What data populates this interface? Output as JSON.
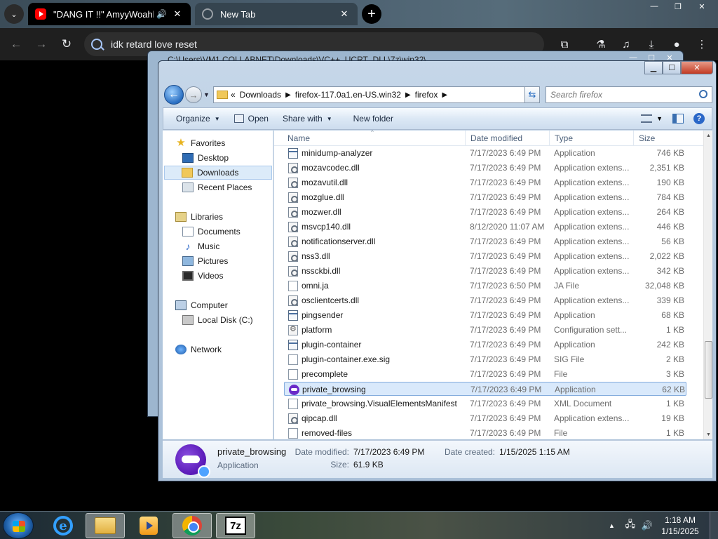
{
  "browser": {
    "tabs": [
      {
        "title": "\"DANG IT !!\" AmyyWoahh"
      },
      {
        "title": "New Tab"
      }
    ],
    "omnibox_value": "idk retard love reset"
  },
  "back_window": {
    "title": "C:\\Users\\VM1.COLLABNET\\Downloads\\VC++_UCRT_DLL\\7z\\win32\\"
  },
  "window": {
    "breadcrumb": [
      "Downloads",
      "firefox-117.0a1.en-US.win32",
      "firefox"
    ],
    "search_placeholder": "Search firefox",
    "toolbar": {
      "organize": "Organize",
      "open": "Open",
      "share_with": "Share with",
      "new_folder": "New folder"
    },
    "nav": {
      "favorites": "Favorites",
      "desktop": "Desktop",
      "downloads": "Downloads",
      "recent_places": "Recent Places",
      "libraries": "Libraries",
      "documents": "Documents",
      "music": "Music",
      "pictures": "Pictures",
      "videos": "Videos",
      "computer": "Computer",
      "local_disk": "Local Disk (C:)",
      "network": "Network"
    },
    "columns": {
      "name": "Name",
      "date": "Date modified",
      "type": "Type",
      "size": "Size"
    },
    "files": [
      {
        "name": "minidump-analyzer",
        "date": "7/17/2023 6:49 PM",
        "type": "Application",
        "size": "746 KB",
        "icon": "app"
      },
      {
        "name": "mozavcodec.dll",
        "date": "7/17/2023 6:49 PM",
        "type": "Application extens...",
        "size": "2,351 KB",
        "icon": "dll"
      },
      {
        "name": "mozavutil.dll",
        "date": "7/17/2023 6:49 PM",
        "type": "Application extens...",
        "size": "190 KB",
        "icon": "dll"
      },
      {
        "name": "mozglue.dll",
        "date": "7/17/2023 6:49 PM",
        "type": "Application extens...",
        "size": "784 KB",
        "icon": "dll"
      },
      {
        "name": "mozwer.dll",
        "date": "7/17/2023 6:49 PM",
        "type": "Application extens...",
        "size": "264 KB",
        "icon": "dll"
      },
      {
        "name": "msvcp140.dll",
        "date": "8/12/2020 11:07 AM",
        "type": "Application extens...",
        "size": "446 KB",
        "icon": "dll"
      },
      {
        "name": "notificationserver.dll",
        "date": "7/17/2023 6:49 PM",
        "type": "Application extens...",
        "size": "56 KB",
        "icon": "dll"
      },
      {
        "name": "nss3.dll",
        "date": "7/17/2023 6:49 PM",
        "type": "Application extens...",
        "size": "2,022 KB",
        "icon": "dll"
      },
      {
        "name": "nssckbi.dll",
        "date": "7/17/2023 6:49 PM",
        "type": "Application extens...",
        "size": "342 KB",
        "icon": "dll"
      },
      {
        "name": "omni.ja",
        "date": "7/17/2023 6:50 PM",
        "type": "JA File",
        "size": "32,048 KB",
        "icon": "file"
      },
      {
        "name": "osclientcerts.dll",
        "date": "7/17/2023 6:49 PM",
        "type": "Application extens...",
        "size": "339 KB",
        "icon": "dll"
      },
      {
        "name": "pingsender",
        "date": "7/17/2023 6:49 PM",
        "type": "Application",
        "size": "68 KB",
        "icon": "app"
      },
      {
        "name": "platform",
        "date": "7/17/2023 6:49 PM",
        "type": "Configuration sett...",
        "size": "1 KB",
        "icon": "conf"
      },
      {
        "name": "plugin-container",
        "date": "7/17/2023 6:49 PM",
        "type": "Application",
        "size": "242 KB",
        "icon": "app"
      },
      {
        "name": "plugin-container.exe.sig",
        "date": "7/17/2023 6:49 PM",
        "type": "SIG File",
        "size": "2 KB",
        "icon": "file"
      },
      {
        "name": "precomplete",
        "date": "7/17/2023 6:49 PM",
        "type": "File",
        "size": "3 KB",
        "icon": "file"
      },
      {
        "name": "private_browsing",
        "date": "7/17/2023 6:49 PM",
        "type": "Application",
        "size": "62 KB",
        "icon": "priv",
        "selected": true
      },
      {
        "name": "private_browsing.VisualElementsManifest",
        "date": "7/17/2023 6:49 PM",
        "type": "XML Document",
        "size": "1 KB",
        "icon": "file"
      },
      {
        "name": "qipcap.dll",
        "date": "7/17/2023 6:49 PM",
        "type": "Application extens...",
        "size": "19 KB",
        "icon": "dll"
      },
      {
        "name": "removed-files",
        "date": "7/17/2023 6:49 PM",
        "type": "File",
        "size": "1 KB",
        "icon": "file"
      }
    ],
    "details": {
      "name": "private_browsing",
      "type": "Application",
      "modified_label": "Date modified:",
      "modified": "7/17/2023 6:49 PM",
      "size_label": "Size:",
      "size": "61.9 KB",
      "created_label": "Date created:",
      "created": "1/15/2025 1:15 AM"
    }
  },
  "taskbar": {
    "time": "1:18 AM",
    "date": "1/15/2025",
    "zip_label": "7z",
    "ie_label": "e"
  }
}
